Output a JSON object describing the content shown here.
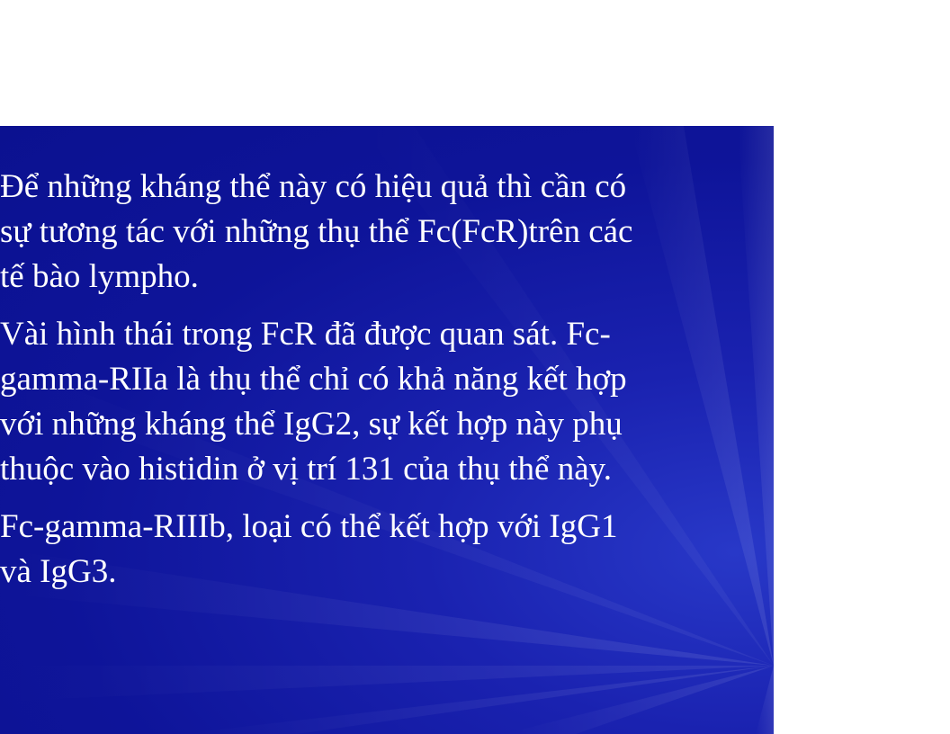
{
  "colors": {
    "background": "#ffffff",
    "slide_background": "#0e1499",
    "text": "#ffffff"
  },
  "paragraphs": [
    {
      "lines": [
        "Để những kháng thể này có hiệu quả thì cần có",
        "sự tương tác với những thụ thể Fc(FcR)trên các",
        "tế bào lympho."
      ]
    },
    {
      "lines": [
        "Vài hình  thái trong FcR đã được quan sát. Fc-",
        "gamma-RIIa là thụ thể chỉ có khả năng kết hợp",
        "với những kháng thể IgG2, sự kết hợp này phụ",
        "thuộc vào histidin ở vị trí 131 của thụ thể này."
      ]
    },
    {
      "lines": [
        "Fc-gamma-RIIIb, loại có thể kết hợp với IgG1",
        "và IgG3."
      ]
    }
  ]
}
